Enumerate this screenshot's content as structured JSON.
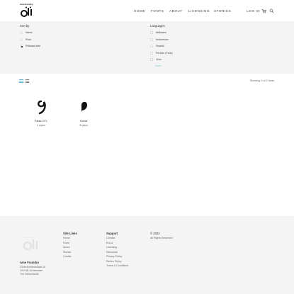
{
  "brand": {
    "logo_small": "Amefoundry",
    "logo_mark": "ﺍﻡﻩ",
    "name": "Ame Foundry"
  },
  "nav": {
    "items": [
      "HOME",
      "FONTS",
      "ABOUT",
      "LICENSING",
      "STORIES"
    ],
    "login": "LOG IN",
    "cart_icon": "cart-icon",
    "search_icon": "search-icon"
  },
  "filters": {
    "sort_title": "Sort by",
    "sort_options": [
      {
        "label": "Name",
        "selected": false
      },
      {
        "label": "Price",
        "selected": false
      },
      {
        "label": "Release date",
        "selected": true
      }
    ],
    "languages_title": "Languages",
    "language_options": [
      "Afrikaans",
      "Indonesian",
      "Swahili",
      "Persian (Farsi)",
      "Urdu"
    ],
    "more_label": "more..."
  },
  "toolbar": {
    "grid_icon": "grid-view-icon",
    "list_icon": "list-view-icon",
    "showing": "Showing 2 of 2 fonts"
  },
  "fonts": [
    {
      "name": "Falak OTL",
      "styles": "4 styles"
    },
    {
      "name": "Kanat",
      "styles": "3 styles"
    }
  ],
  "footer": {
    "site_links_title": "Site Links",
    "site_links": [
      "Home",
      "Fonts",
      "About",
      "Stories",
      "Credits"
    ],
    "support_title": "Support",
    "support_links": [
      "Contact",
      "EULA",
      "Licensing",
      "Discounts",
      "Privacy Policy",
      "Return Policy",
      "Terms & Conditions"
    ],
    "copyright": "© 2022",
    "rights": "All Rights Reserved",
    "address": [
      "Groenhoedenstraat 10",
      "1019 BL Amsterdam",
      "The Netherlands"
    ]
  },
  "colors": {
    "accent_more": "#7fc8d8",
    "panel_bg": "#f4f4f4",
    "grid_icon_active": "#5bb5d0"
  }
}
